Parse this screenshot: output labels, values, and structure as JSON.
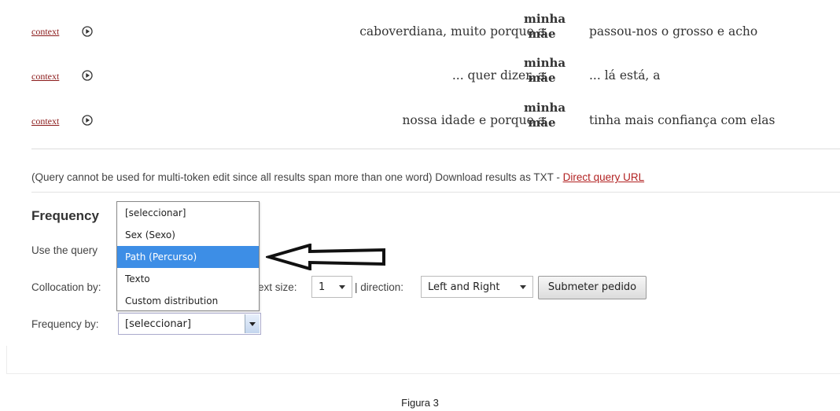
{
  "results": [
    {
      "context_link": "context",
      "left": "caboverdiana, muito porque a",
      "match_line1": "minha",
      "match_line2": "mãe",
      "right": "passou-nos o grosso e acho"
    },
    {
      "context_link": "context",
      "left": "... quer dizer, a",
      "match_line1": "minha",
      "match_line2": "mãe",
      "right": "... lá está, a"
    },
    {
      "context_link": "context",
      "left": "nossa idade e porque a",
      "match_line1": "minha",
      "match_line2": "mãe",
      "right": "tinha mais confiança com elas"
    }
  ],
  "info": {
    "text": "(Query cannot be used for multi-token edit since all results span more than one word) Download results as TXT - ",
    "direct_query_link": "Direct query URL"
  },
  "frequency": {
    "heading": "Frequency",
    "use_query": "Use the query",
    "collocation_label": "Collocation by:",
    "context_size_label": "ext size:",
    "context_size_value": "1",
    "direction_label": "| direction:",
    "direction_value": "Left and Right",
    "submit_label": "Submeter pedido",
    "frequency_by_label": "Frequency by:",
    "frequency_by_value": "[seleccionar]",
    "dropdown_options": [
      "[seleccionar]",
      "Sex (Sexo)",
      "Path (Percurso)",
      "Texto",
      "Custom distribution"
    ],
    "dropdown_selected_index": 2
  },
  "caption": "Figura 3",
  "colors": {
    "link": "#b22222",
    "highlight": "#3d8ee6"
  },
  "icons": {
    "play": "play-circle-icon",
    "annotation_arrow": "left-arrow-icon"
  }
}
